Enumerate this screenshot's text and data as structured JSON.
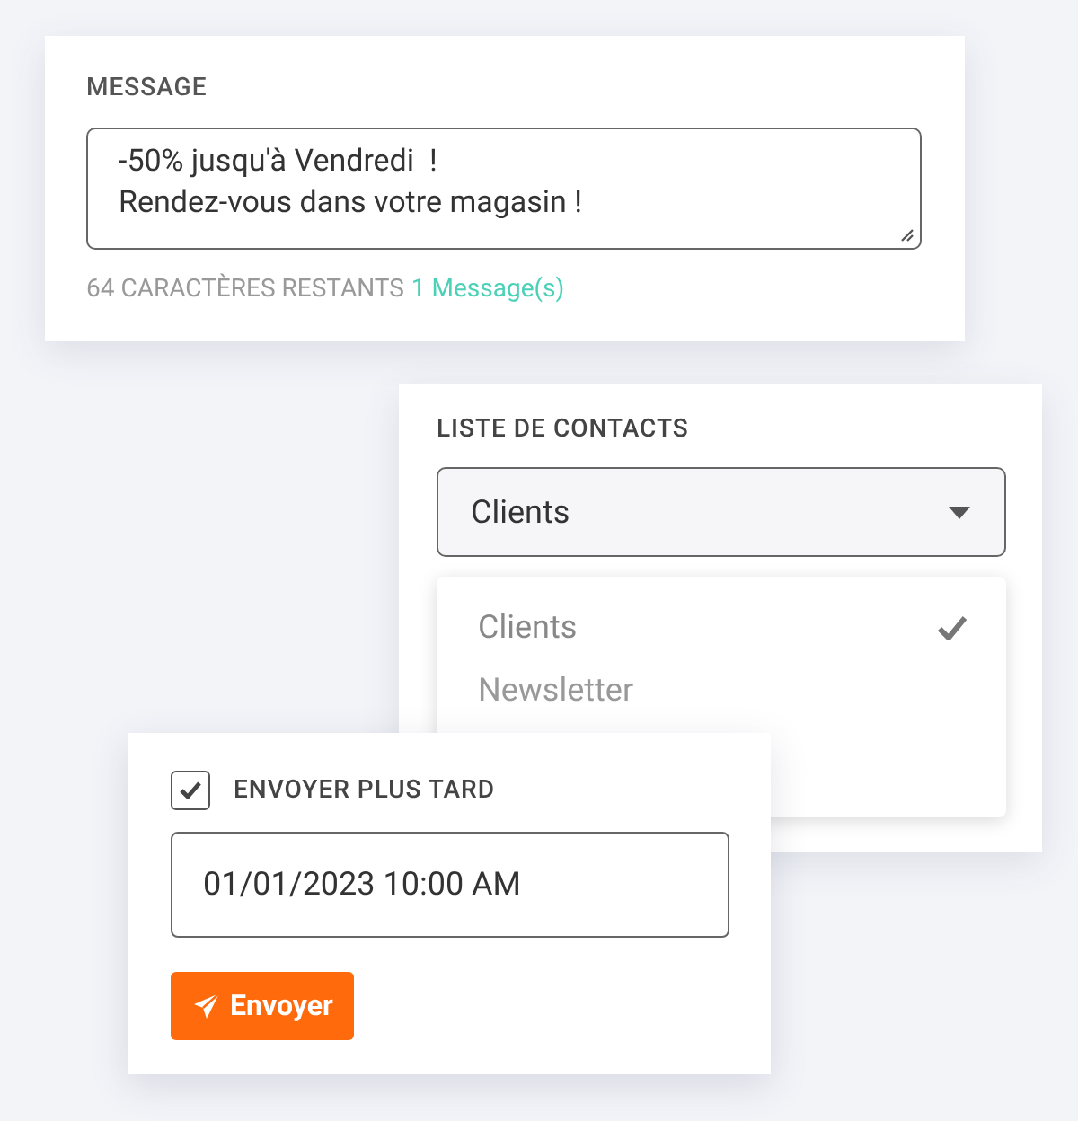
{
  "message_card": {
    "label": "MESSAGE",
    "value": "-50% jusqu'à Vendredi  !\nRendez-vous dans votre magasin !",
    "remaining": "64 CARACTÈRES RESTANTS",
    "count": "1 Message(s)"
  },
  "contacts_card": {
    "label": "LISTE DE CONTACTS",
    "select_value": "Clients",
    "expanded": true,
    "options": [
      {
        "label": "Clients",
        "selected": true
      },
      {
        "label": "Newsletter",
        "selected": false
      }
    ]
  },
  "schedule_card": {
    "checkbox_label": "ENVOYER PLUS TARD",
    "checked": true,
    "datetime": "01/01/2023 10:00 AM",
    "button": "Envoyer"
  }
}
